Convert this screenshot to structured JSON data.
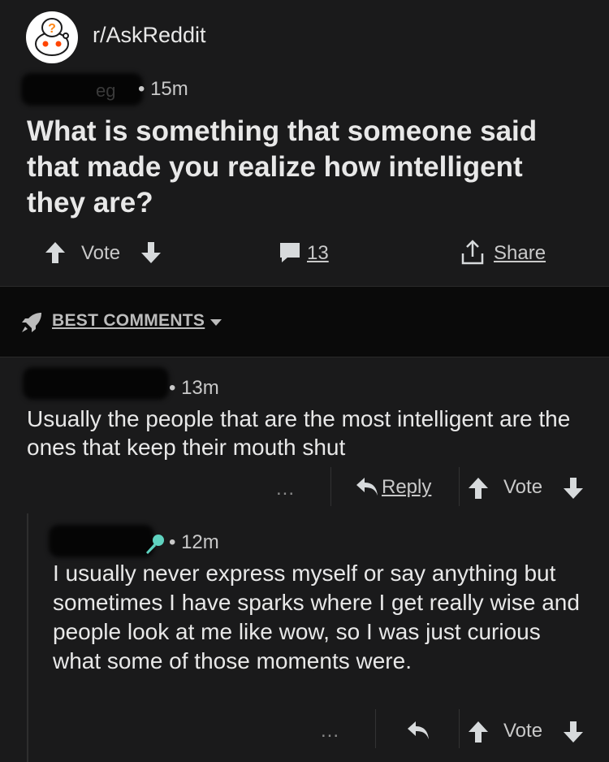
{
  "subreddit": {
    "name": "r/AskReddit",
    "icon": "askreddit-snoo-icon"
  },
  "post": {
    "author_tail": "eg",
    "time": "• 15m",
    "title": "What is something that someone said that made you realize how intelligent they are?",
    "actions": {
      "vote_label": "Vote",
      "comment_count": "13",
      "share_label": "Share"
    }
  },
  "sort": {
    "label": "BEST COMMENTS",
    "icon": "rocket-icon"
  },
  "comments": [
    {
      "time": "• 13m",
      "body": "Usually the people that are the most intelligent are the ones that keep their mouth shut",
      "more": "...",
      "reply_label": "Reply",
      "vote_label": "Vote"
    },
    {
      "time": "• 12m",
      "flair_icon": "microphone-icon",
      "body": "I usually never express myself or say anything but sometimes I have sparks where I get really wise and people look at me like wow, so I was just curious what some of those moments were.",
      "more": "...",
      "vote_label": "Vote"
    }
  ],
  "colors": {
    "background": "#1a1a1b",
    "text": "#e8e8e8",
    "muted": "#c9c9c9",
    "flair": "#5fd3c0",
    "askreddit_orange": "#ff8717"
  }
}
